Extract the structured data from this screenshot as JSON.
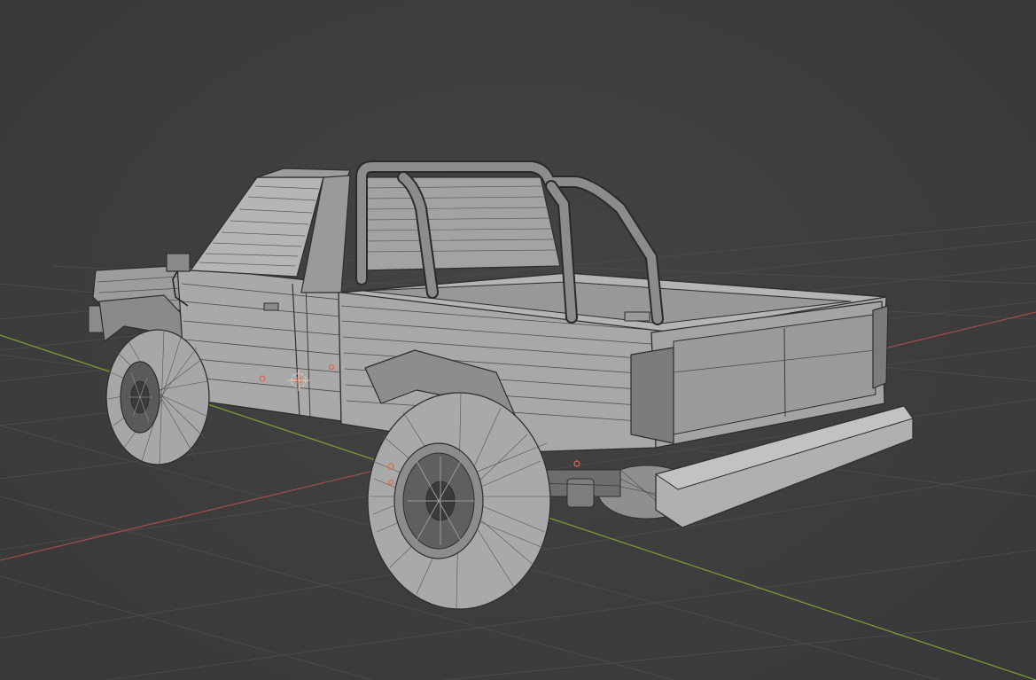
{
  "viewport": {
    "mode": "wireframe-overlay",
    "background_color": "#3d3d3d",
    "grid_color": "#4a4a4a",
    "x_axis_color": "#9e4b4f",
    "y_axis_color": "#7a9a3a"
  },
  "scene": {
    "object_icon": "pickup-truck-mesh",
    "mesh_base_color": "#a6a6a6",
    "wire_color": "#3a3a3a",
    "vertex_marker_color": "#e06a4a"
  }
}
